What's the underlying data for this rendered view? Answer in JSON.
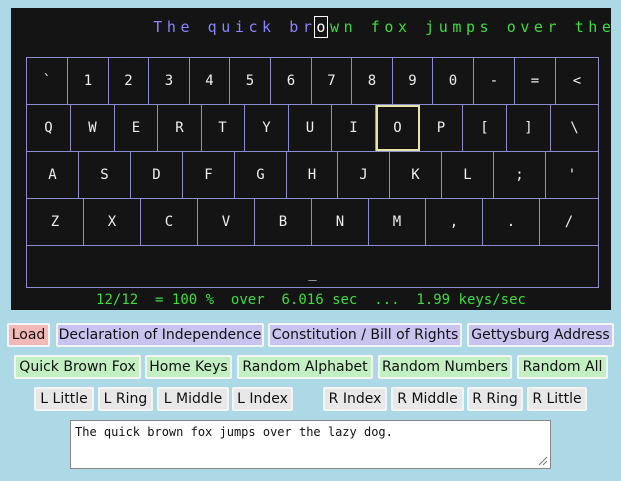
{
  "typing": {
    "done": "The quick br",
    "current": "o",
    "remaining": "wn fox jumps over the lazy dog."
  },
  "keyboard": {
    "highlight": "O",
    "rows": [
      [
        "`",
        "1",
        "2",
        "3",
        "4",
        "5",
        "6",
        "7",
        "8",
        "9",
        "0",
        "-",
        "=",
        "<"
      ],
      [
        "Q",
        "W",
        "E",
        "R",
        "T",
        "Y",
        "U",
        "I",
        "O",
        "P",
        "[",
        "]",
        "\\"
      ],
      [
        "A",
        "S",
        "D",
        "F",
        "G",
        "H",
        "J",
        "K",
        "L",
        ";",
        "'"
      ],
      [
        "Z",
        "X",
        "C",
        "V",
        "B",
        "N",
        "M",
        ",",
        ".",
        "/"
      ],
      [
        "_"
      ]
    ]
  },
  "stats": {
    "progress": "12/12",
    "accuracy": "= 100 %",
    "time": "over  6.016 sec",
    "sep": "...",
    "speed": "1.99 keys/sec"
  },
  "buttons": {
    "load": "Load",
    "declaration": "Declaration of Independence",
    "constitution": "Constitution / Bill of Rights",
    "gettysburg": "Gettysburg Address",
    "quick_brown_fox": "Quick Brown Fox",
    "home_keys": "Home Keys",
    "random_alphabet": "Random Alphabet",
    "random_numbers": "Random Numbers",
    "random_all": "Random All",
    "l_little": "L Little",
    "l_ring": "L Ring",
    "l_middle": "L Middle",
    "l_index": "L Index",
    "r_index": "R Index",
    "r_middle": "R Middle",
    "r_ring": "R Ring",
    "r_little": "R Little"
  },
  "text_input": {
    "value": "The quick brown fox jumps over the lazy dog."
  },
  "colors": {
    "background": "#add8e6",
    "screen": "#141414",
    "typed": "#8a84ff",
    "pending": "#3fdc3f",
    "key_border": "#8c8cd0",
    "highlight_key": "#e6e6a8",
    "load_button": "#f3b8b8",
    "document_button": "#c9c3f0",
    "generator_button": "#c2f0c2",
    "finger_button": "#e8e8e8"
  }
}
